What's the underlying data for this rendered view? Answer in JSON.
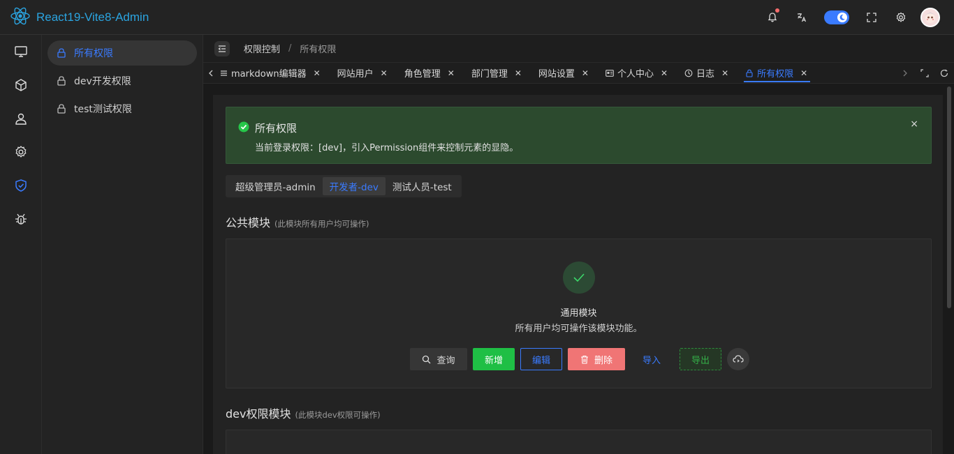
{
  "app": {
    "title": "React19-Vite8-Admin"
  },
  "header": {
    "icons": [
      "bell-icon",
      "translate-icon",
      "theme-toggle",
      "fullscreen-icon",
      "settings-icon",
      "avatar"
    ]
  },
  "icon_sidebar": [
    {
      "icon": "monitor-icon"
    },
    {
      "icon": "cube-icon"
    },
    {
      "icon": "user-icon"
    },
    {
      "icon": "gear-icon"
    },
    {
      "icon": "shield-icon",
      "active": true
    },
    {
      "icon": "bug-icon"
    }
  ],
  "submenu": {
    "items": [
      {
        "label": "所有权限",
        "active": true
      },
      {
        "label": "dev开发权限"
      },
      {
        "label": "test测试权限"
      }
    ]
  },
  "breadcrumb": {
    "parent": "权限控制",
    "separator": "/",
    "current": "所有权限"
  },
  "tabs": [
    {
      "label": "markdown编辑器"
    },
    {
      "label": "网站用户"
    },
    {
      "label": "角色管理"
    },
    {
      "label": "部门管理"
    },
    {
      "label": "网站设置"
    },
    {
      "label": "个人中心"
    },
    {
      "label": "日志"
    },
    {
      "label": "所有权限",
      "active": true
    }
  ],
  "alert": {
    "title": "所有权限",
    "description": "当前登录权限：[dev]，引入Permission组件来控制元素的显隐。",
    "close": "×"
  },
  "role_segment": {
    "options": [
      "超级管理员-admin",
      "开发者-dev",
      "测试人员-test"
    ],
    "selected": "开发者-dev"
  },
  "sections": {
    "public": {
      "title": "公共模块",
      "hint": "(此模块所有用户均可操作)"
    },
    "dev": {
      "title": "dev权限模块",
      "hint": "(此模块dev权限可操作)"
    }
  },
  "public_module": {
    "title": "通用模块",
    "description": "所有用户均可操作该模块功能。",
    "buttons": {
      "query": "查询",
      "add": "新增",
      "edit": "编辑",
      "delete": "删除",
      "import": "导入",
      "export": "导出"
    }
  },
  "colors": {
    "accent": "#3a7bff",
    "success": "#1fbf45",
    "danger": "#f07575",
    "alert_bg": "#2c4a2e"
  }
}
